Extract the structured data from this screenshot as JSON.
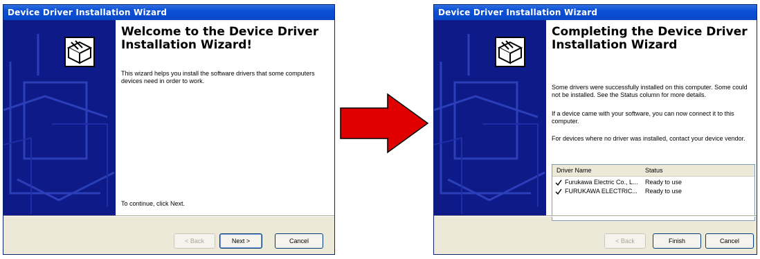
{
  "left_window": {
    "title": "Device Driver Installation Wizard",
    "heading": "Welcome to the Device Driver Installation Wizard!",
    "intro": "This wizard helps you install the software drivers that some computers devices need in order to work.",
    "continue_text": "To continue, click Next.",
    "back_label": "< Back",
    "next_label": "Next >",
    "cancel_label": "Cancel"
  },
  "right_window": {
    "title": "Device Driver Installation Wizard",
    "heading": "Completing the Device Driver Installation Wizard",
    "para1": "Some drivers were successfully installed on this computer. Some could not be installed. See the Status column for more details.",
    "para2": "If a device came with your software, you can now connect it to this computer.",
    "para3": "For devices where no driver was installed, contact your device vendor.",
    "table": {
      "columns": [
        "Driver Name",
        "Status"
      ],
      "rows": [
        {
          "name": "Furukawa Electric Co., L...",
          "status": "Ready to use"
        },
        {
          "name": "FURUKAWA ELECTRIC...",
          "status": "Ready to use"
        }
      ]
    },
    "back_label": "< Back",
    "finish_label": "Finish",
    "cancel_label": "Cancel"
  },
  "icons": {
    "wizard": "driver-box-icon",
    "check": "checkmark-icon",
    "arrow": "right-arrow-icon"
  },
  "colors": {
    "titlebar": "#0a49c8",
    "sidepanel": "#0d1a87",
    "arrow": "#e00000"
  }
}
